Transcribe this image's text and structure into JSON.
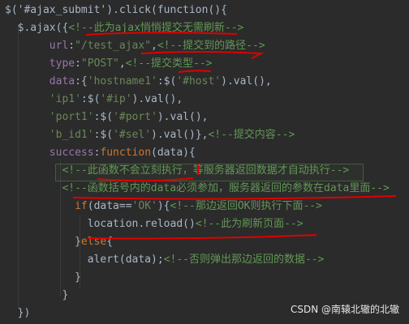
{
  "lines": [
    {
      "tokens": [
        {
          "t": "$('#ajax_submit').click(function(){",
          "c": "punc"
        }
      ]
    },
    {
      "tokens": [
        {
          "t": "  $.ajax({",
          "c": "punc"
        },
        {
          "t": "<!--此为ajax悄悄提交无需刷新-->",
          "c": "comment"
        }
      ]
    },
    {
      "tokens": [
        {
          "t": "       url",
          "c": "prop"
        },
        {
          "t": ":",
          "c": "punc"
        },
        {
          "t": "\"/test_ajax\"",
          "c": "str"
        },
        {
          "t": ",",
          "c": "punc"
        },
        {
          "t": "<!--提交到的路径-->",
          "c": "comment"
        }
      ]
    },
    {
      "tokens": [
        {
          "t": "       type",
          "c": "prop"
        },
        {
          "t": ":",
          "c": "punc"
        },
        {
          "t": "\"POST\"",
          "c": "str"
        },
        {
          "t": ",",
          "c": "punc"
        },
        {
          "t": "<!--提交类型-->",
          "c": "comment"
        }
      ]
    },
    {
      "tokens": [
        {
          "t": "       data",
          "c": "prop"
        },
        {
          "t": ":{",
          "c": "punc"
        },
        {
          "t": "'hostname1'",
          "c": "str"
        },
        {
          "t": ":$(",
          "c": "punc"
        },
        {
          "t": "'#host'",
          "c": "str"
        },
        {
          "t": ").val(),",
          "c": "punc"
        }
      ]
    },
    {
      "tokens": [
        {
          "t": "       'ip1'",
          "c": "str"
        },
        {
          "t": ":$(",
          "c": "punc"
        },
        {
          "t": "'#ip'",
          "c": "str"
        },
        {
          "t": ").val(),",
          "c": "punc"
        }
      ]
    },
    {
      "tokens": [
        {
          "t": "       'port1'",
          "c": "str"
        },
        {
          "t": ":$(",
          "c": "punc"
        },
        {
          "t": "'#port'",
          "c": "str"
        },
        {
          "t": ").val(),",
          "c": "punc"
        }
      ]
    },
    {
      "tokens": [
        {
          "t": "       'b_id1'",
          "c": "str"
        },
        {
          "t": ":$(",
          "c": "punc"
        },
        {
          "t": "'#sel'",
          "c": "str"
        },
        {
          "t": ").val()},",
          "c": "punc"
        },
        {
          "t": "<!--提交内容-->",
          "c": "comment"
        }
      ]
    },
    {
      "tokens": [
        {
          "t": "       success",
          "c": "prop"
        },
        {
          "t": ":",
          "c": "punc"
        },
        {
          "t": "function",
          "c": "kw"
        },
        {
          "t": "(data){",
          "c": "punc"
        }
      ]
    },
    {
      "tokens": [
        {
          "t": "         <!--此函数不会立刻执行，等服务器返回数据才自动执行-->",
          "c": "comment"
        }
      ]
    },
    {
      "tokens": [
        {
          "t": "         <!--函数括号内的data必须参加，服务器返回的参数在data里面-->",
          "c": "comment"
        }
      ]
    },
    {
      "tokens": [
        {
          "t": "           if",
          "c": "kw"
        },
        {
          "t": "(data==",
          "c": "punc"
        },
        {
          "t": "'OK'",
          "c": "str"
        },
        {
          "t": "){",
          "c": "punc"
        },
        {
          "t": "<!--那边返回OK则执行下面-->",
          "c": "comment"
        }
      ]
    },
    {
      "tokens": [
        {
          "t": "             location.reload()",
          "c": "punc"
        },
        {
          "t": "<!--此为刷新页面-->",
          "c": "comment"
        }
      ]
    },
    {
      "tokens": [
        {
          "t": "           }",
          "c": "punc"
        },
        {
          "t": "else",
          "c": "kw"
        },
        {
          "t": "{",
          "c": "punc"
        }
      ]
    },
    {
      "tokens": [
        {
          "t": "             alert(data);",
          "c": "punc"
        },
        {
          "t": "<!--否则弹出那边返回的数据-->",
          "c": "comment"
        }
      ]
    },
    {
      "tokens": [
        {
          "t": "           }",
          "c": "punc"
        }
      ]
    },
    {
      "tokens": [
        {
          "t": "         }",
          "c": "punc"
        }
      ]
    },
    {
      "tokens": [
        {
          "t": "  })",
          "c": "punc"
        }
      ]
    }
  ],
  "watermark": "CSDN @南辕北辙的北辙",
  "colors": {
    "background": "#2b2b2b",
    "default": "#a9b7c6",
    "keyword": "#cc7832",
    "property": "#9876aa",
    "string": "#6a8759",
    "comment": "#629755",
    "annotation_ink": "#e00000"
  }
}
